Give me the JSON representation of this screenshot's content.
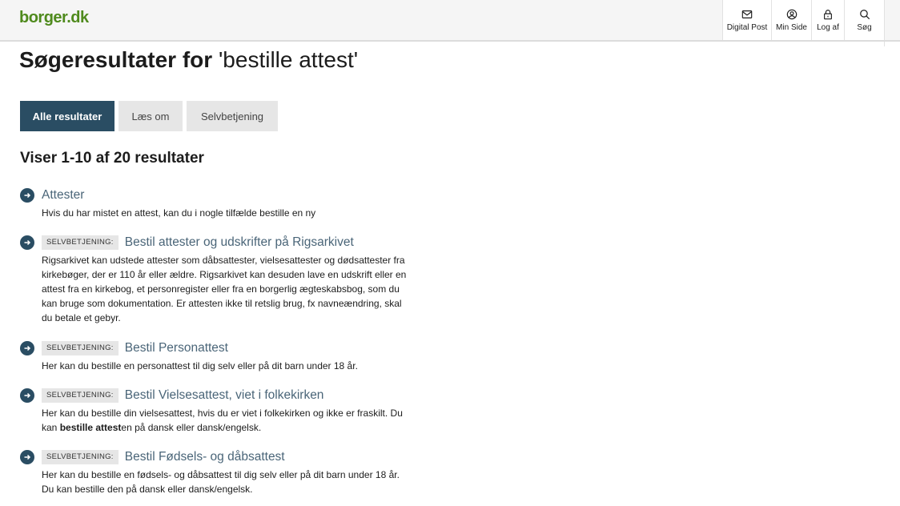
{
  "header": {
    "logo": "borger.dk",
    "nav": [
      {
        "label": "Digital Post",
        "icon": "mail-icon"
      },
      {
        "label": "Min Side",
        "icon": "user-icon"
      },
      {
        "label": "Log af",
        "icon": "lock-icon"
      },
      {
        "label": "Søg",
        "icon": "search-icon"
      }
    ]
  },
  "page": {
    "title_prefix": "Søgeresultater for",
    "query": "'bestille attest'",
    "count": "Viser 1-10 af 20 resultater"
  },
  "tabs": [
    {
      "label": "Alle resultater",
      "active": true
    },
    {
      "label": "Læs om",
      "active": false
    },
    {
      "label": "Selvbetjening",
      "active": false
    }
  ],
  "results": [
    {
      "badge": "",
      "title": "Attester",
      "desc": "Hvis du har mistet en attest, kan du i nogle tilfælde bestille en ny"
    },
    {
      "badge": "SELVBETJENING:",
      "title": "Bestil attester og udskrifter på Rigsarkivet",
      "desc": "Rigsarkivet kan udstede attester som dåbsattester, vielsesattester og dødsattester fra kirkebøger, der er 110 år eller ældre. Rigsarkivet kan desuden lave en udskrift eller en attest fra en kirkebog, et personregister eller fra en borgerlig ægteskabsbog, som du kan bruge som dokumentation. Er attesten ikke til retslig brug, fx navneændring, skal du betale et gebyr."
    },
    {
      "badge": "SELVBETJENING:",
      "title": "Bestil Personattest",
      "desc": "Her kan du bestille en personattest til dig selv eller på dit barn under 18 år."
    },
    {
      "badge": "SELVBETJENING:",
      "title": "Bestil Vielsesattest, viet i folkekirken",
      "desc_before": "Her kan du bestille din vielsesattest, hvis du er viet i folkekirken og ikke er fraskilt. Du kan ",
      "desc_bold": "bestille attest",
      "desc_after": "en på dansk eller dansk/engelsk."
    },
    {
      "badge": "SELVBETJENING:",
      "title": "Bestil Fødsels- og dåbsattest",
      "desc": "Her kan du bestille en fødsels- og dåbsattest til dig selv eller på dit barn under 18 år. Du kan bestille den på dansk eller dansk/engelsk."
    }
  ],
  "colors": {
    "brand_green": "#4f8a1d",
    "primary_navy": "#2a4d63",
    "link": "#4a6578",
    "tab_inactive": "#e6e6e6"
  }
}
